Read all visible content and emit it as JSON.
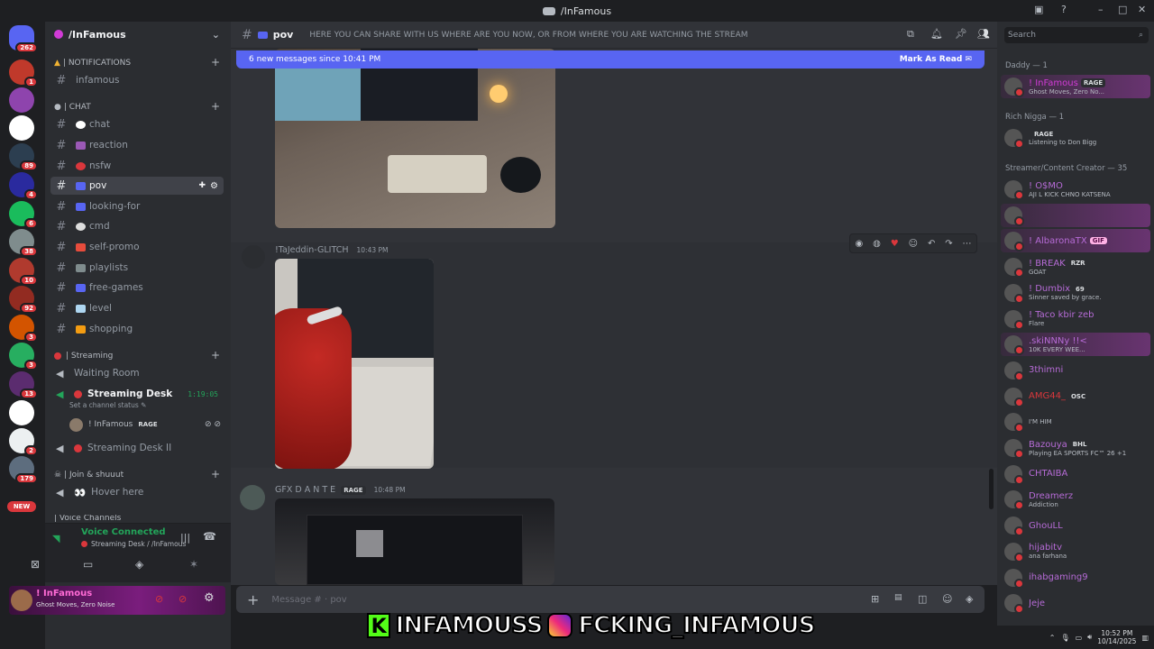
{
  "window": {
    "title": "/InFamous"
  },
  "rail": {
    "home_badge": "262",
    "servers": [
      {
        "badge": "1",
        "color": "#c0392b"
      },
      {
        "badge": "",
        "color": "#8e44ad"
      },
      {
        "badge": "",
        "color": "#ffffff"
      },
      {
        "badge": "89",
        "color": "#2c3e50"
      },
      {
        "badge": "4",
        "color": "#2a2a9e"
      },
      {
        "badge": "6",
        "color": "#1abc5c"
      },
      {
        "badge": "38",
        "color": "#7f8c8d"
      },
      {
        "badge": "10",
        "color": "#b03a2e"
      },
      {
        "badge": "92",
        "color": "#922b21"
      },
      {
        "badge": "3",
        "color": "#d35400"
      },
      {
        "badge": "3",
        "color": "#27ae60"
      },
      {
        "badge": "13",
        "color": "#5b2c6f"
      },
      {
        "badge": "",
        "color": "#ffffff"
      },
      {
        "badge": "2",
        "color": "#ecf0f1"
      },
      {
        "badge": "179",
        "color": "#5d6d7e"
      }
    ],
    "new_label": "NEW"
  },
  "sidebar": {
    "server_name": "/InFamous",
    "cat_notifications": "| NOTIFICATIONS",
    "cat_chat": "| CHAT",
    "cat_streaming": "| Streaming",
    "cat_join": "| Join & shuuut",
    "cat_voice": "| Voice Channels",
    "channels": {
      "infamous": "infamous",
      "chat": "chat",
      "reaction": "reaction",
      "nsfw": "nsfw",
      "pov": "pov",
      "looking_for": "looking-for",
      "cmd": "cmd",
      "self_promo": "self-promo",
      "playlists": "playlists",
      "free_games": "free-games",
      "level": "level",
      "shopping": "shopping",
      "waiting_room": "Waiting Room",
      "streaming_desk": "Streaming Desk",
      "streaming_time": "1:19:05",
      "set_status": "Set a channel status",
      "stream_user": "! InFamous",
      "stream_user_tag": "RAGE",
      "streaming_desk_2": "Streaming Desk II",
      "hover_here": "Hover here"
    }
  },
  "voice": {
    "status": "Voice Connected",
    "location": "Streaming Desk / /InFamous"
  },
  "user": {
    "name": "! InFamous",
    "status": "Ghost Moves, Zero Noise"
  },
  "header": {
    "channel": "pov",
    "topic": "HERE YOU CAN SHARE WITH US WHERE ARE YOU NOW, OR FROM WHERE YOU ARE WATCHING THE STREAM"
  },
  "new_messages": {
    "text": "6 new messages since 10:41 PM",
    "action": "Mark As Read"
  },
  "messages": [
    {
      "author": "!TaJeddin-GLITCH",
      "time": "10:43 PM"
    },
    {
      "author": "GFX D A N T E",
      "tag": "RAGE",
      "time": "10:48 PM"
    }
  ],
  "composer": {
    "placeholder": "Message # · pov"
  },
  "members": {
    "search_placeholder": "Search",
    "groups": [
      {
        "header": "Daddy — 1",
        "items": [
          {
            "name": "! InFamous",
            "tag": "RAGE",
            "status": "Ghost Moves, Zero No...",
            "color": "#d13bd6"
          }
        ]
      },
      {
        "header": "Rich Nigga — 1",
        "items": [
          {
            "name": "",
            "tag": "RAGE",
            "status": "Listening to Don Bigg",
            "color": "#949ba4"
          }
        ]
      },
      {
        "header": "Streamer/Content Creator — 35",
        "items": [
          {
            "name": "! O$MO",
            "status": "AJI L KICK CHNO KATSENA",
            "color": "#b66bd6"
          },
          {
            "name": "",
            "status": "",
            "color": "#b66bd6"
          },
          {
            "name": "! AlbaronaTX",
            "tag": "GIF",
            "status": "",
            "color": "#b66bd6"
          },
          {
            "name": "! BREAK",
            "tag": "RZR",
            "status": "GOAT",
            "color": "#b66bd6"
          },
          {
            "name": "! Dumbix",
            "tag": "69",
            "status": "Sinner saved by grace.",
            "color": "#b66bd6"
          },
          {
            "name": "! Taco kbir zeb",
            "status": "Flare",
            "color": "#b66bd6"
          },
          {
            "name": ".skiNNNy !!<",
            "status": "10K EVERY WEE...",
            "color": "#b66bd6"
          },
          {
            "name": "3thimni",
            "status": "",
            "color": "#b66bd6"
          },
          {
            "name": "AMG44_",
            "tag": "OSC",
            "status": "",
            "color": "#da373c"
          },
          {
            "name": "",
            "status": "I'M HIM",
            "color": "#b66bd6"
          },
          {
            "name": "Bazouya",
            "tag": "BHL",
            "status": "Playing EA SPORTS FC™ 26 +1",
            "color": "#b66bd6"
          },
          {
            "name": "CHTAIBA",
            "status": "",
            "color": "#b66bd6"
          },
          {
            "name": "Dreamerz",
            "status": "Addiction",
            "color": "#b66bd6"
          },
          {
            "name": "GhouLL",
            "status": "",
            "color": "#b66bd6"
          },
          {
            "name": "hijabitv",
            "status": "ana farhana",
            "color": "#b66bd6"
          },
          {
            "name": "ihabgaming9",
            "status": "",
            "color": "#b66bd6"
          },
          {
            "name": "Jeje",
            "status": "",
            "color": "#b66bd6"
          }
        ]
      }
    ]
  },
  "overlay": {
    "kick": "INFAMOUSS",
    "instagram": "FCKING_INFAMOUS"
  },
  "taskbar": {
    "time": "10:52 PM",
    "date": "10/14/2025"
  }
}
